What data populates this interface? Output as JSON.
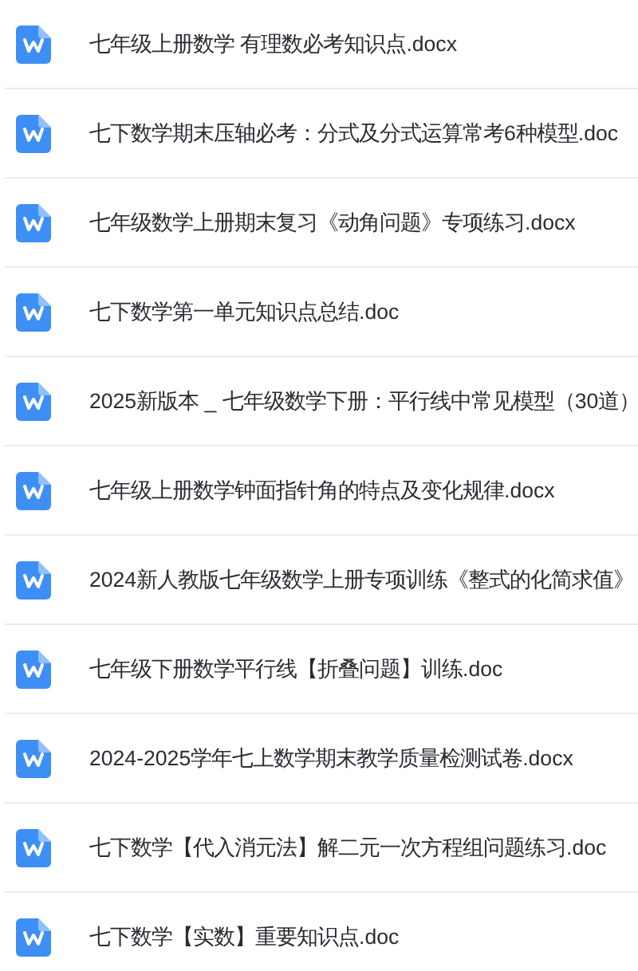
{
  "files": [
    {
      "name": "七年级上册数学 有理数必考知识点.docx"
    },
    {
      "name": "七下数学期末压轴必考：分式及分式运算常考6种模型.doc"
    },
    {
      "name": "七年级数学上册期末复习《动角问题》专项练习.docx"
    },
    {
      "name": "七下数学第一单元知识点总结.doc"
    },
    {
      "name": "2025新版本 _ 七年级数学下册：平行线中常见模型（30道）"
    },
    {
      "name": "七年级上册数学钟面指针角的特点及变化规律.docx"
    },
    {
      "name": "2024新人教版七年级数学上册专项训练《整式的化简求值》"
    },
    {
      "name": "七年级下册数学平行线【折叠问题】训练.doc"
    },
    {
      "name": "2024-2025学年七上数学期末教学质量检测试卷.docx"
    },
    {
      "name": "七下数学【代入消元法】解二元一次方程组问题练习.doc"
    },
    {
      "name": "七下数学【实数】重要知识点.doc"
    }
  ]
}
